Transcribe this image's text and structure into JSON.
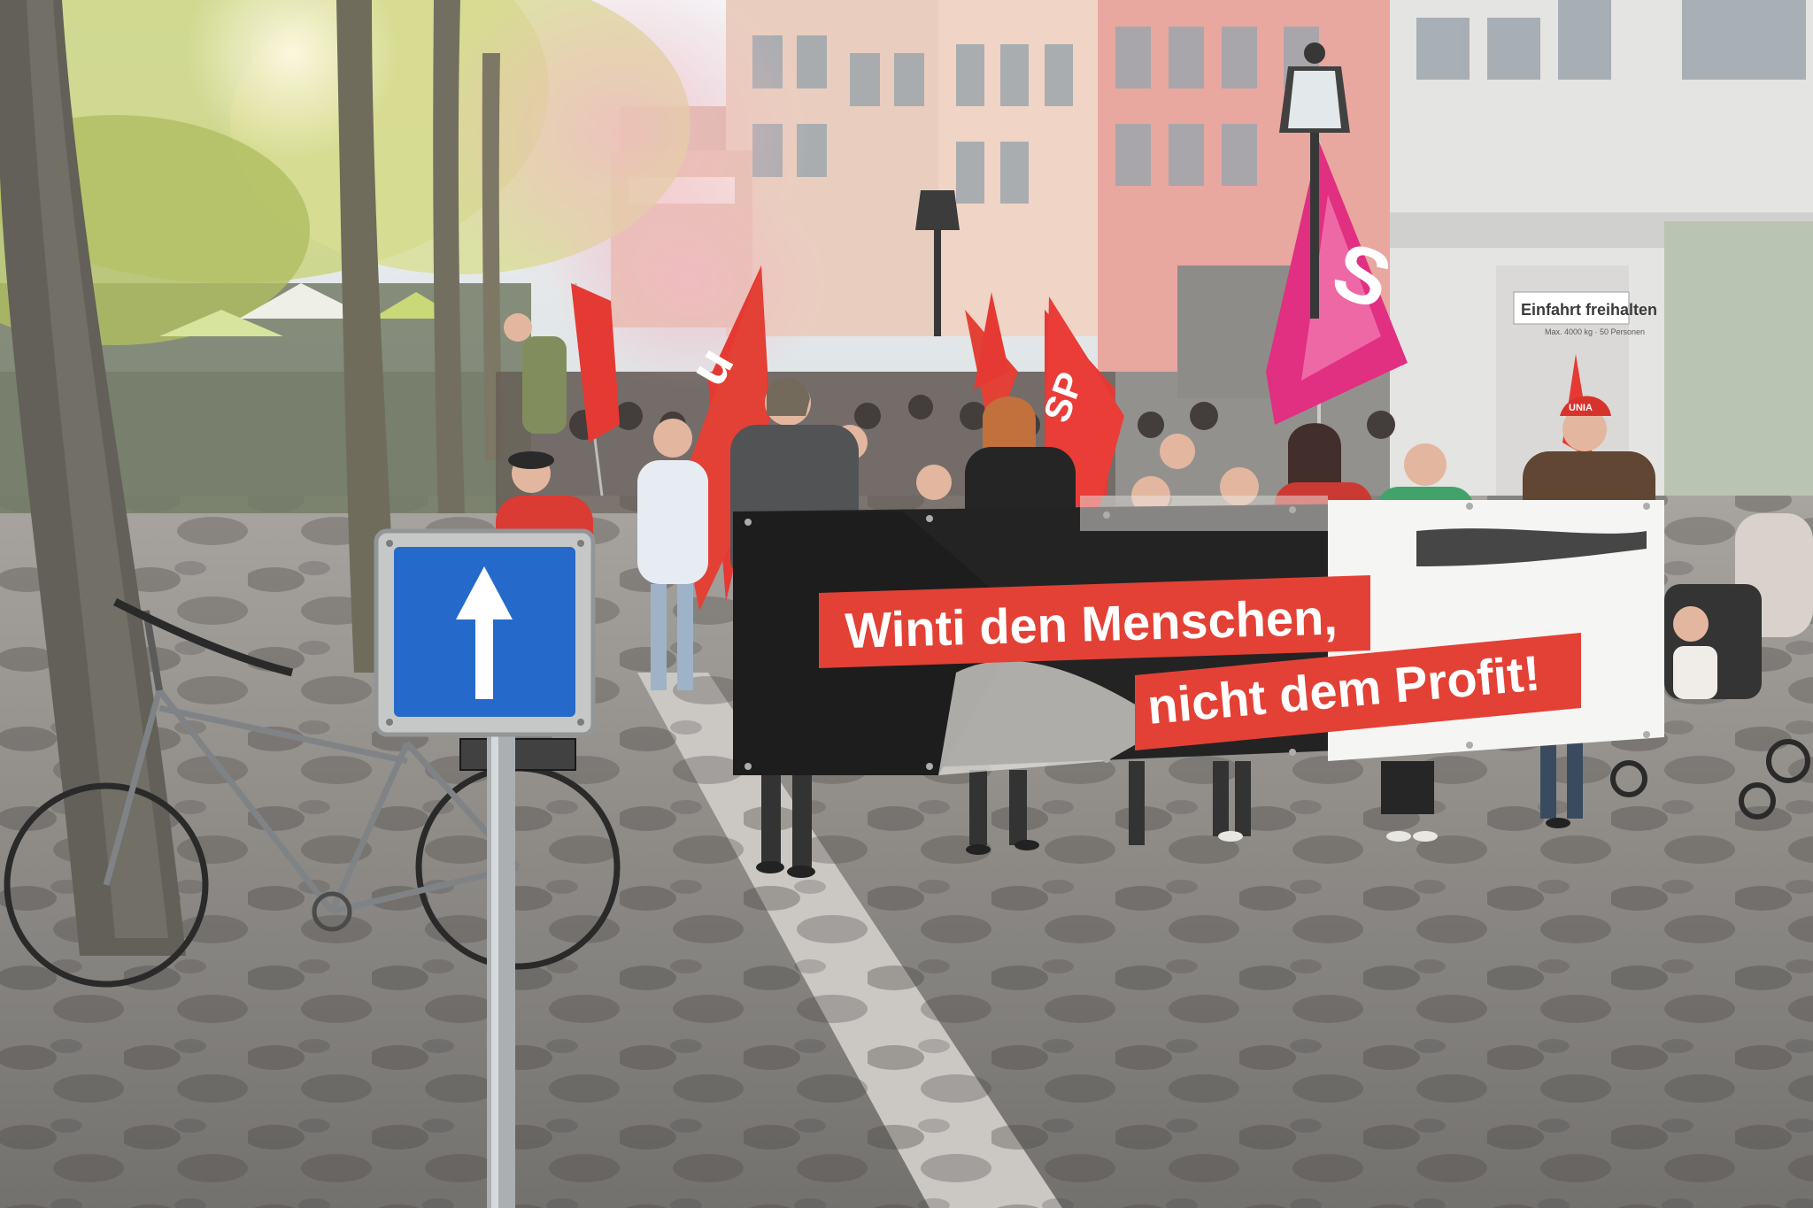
{
  "scene": {
    "description_label": "Street demonstration photo",
    "colors": {
      "sky": "#e9eef2",
      "pavement": "#8f8d8a",
      "banner_red": "#e23a2e",
      "banner_black": "#1c1b1b",
      "sign_blue": "#1d64c8",
      "flag_red": "#e4322b",
      "flag_pink": "#e0277d",
      "foliage": "#b9c860"
    }
  },
  "banner": {
    "line1": "Winti den Menschen,",
    "line2": "nicht dem Profit!"
  },
  "storefront_sign": {
    "title": "Einfahrt freihalten",
    "subtitle": "Max. 4000 kg · 50 Personen"
  },
  "flags": {
    "unia_short": "u",
    "sp_short": "SP",
    "pink_mark": "S"
  },
  "caps": {
    "unia_label": "UNIA"
  },
  "traffic_sign": {
    "icon": "one-way-arrow-icon"
  }
}
